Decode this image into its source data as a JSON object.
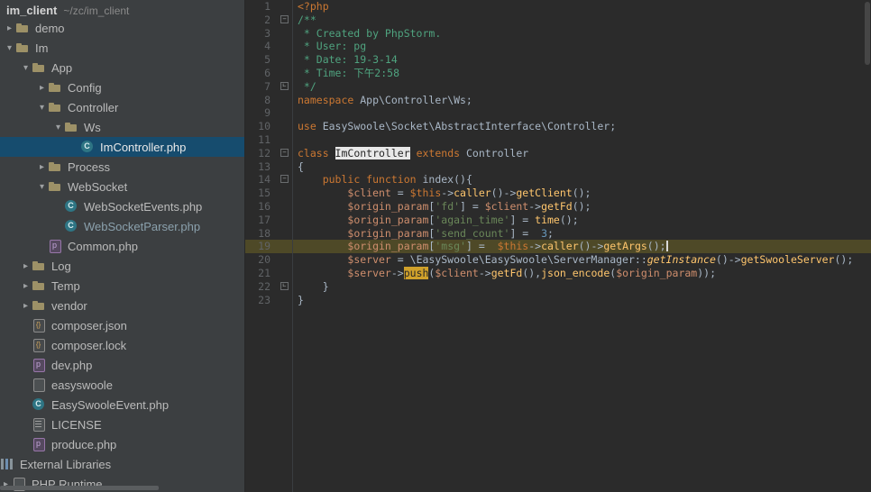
{
  "colors": {
    "editor_bg": "#2b2b2b",
    "sidebar_bg": "#3c3f41",
    "tree_selection": "#164c6e",
    "caret_line": "#4e4927",
    "keyword": "#cc7832",
    "variable": "#cf8e6d",
    "string": "#6a8759",
    "number": "#6897bb",
    "method": "#ffc66d",
    "comment": "#4fa37f",
    "identifier_highlight": "#e8e8e8",
    "usage_highlight": "#d0a12b"
  },
  "sidebar": {
    "root": {
      "name": "im_client",
      "path": "~/zc/im_client"
    },
    "items": [
      {
        "label": "demo",
        "type": "folder",
        "indent": 4,
        "arrow": "right"
      },
      {
        "label": "Im",
        "type": "folder",
        "indent": 4,
        "arrow": "down"
      },
      {
        "label": "App",
        "type": "folder",
        "indent": 22,
        "arrow": "down"
      },
      {
        "label": "Config",
        "type": "folder",
        "indent": 40,
        "arrow": "right"
      },
      {
        "label": "Controller",
        "type": "folder",
        "indent": 40,
        "arrow": "down"
      },
      {
        "label": "Ws",
        "type": "folder",
        "indent": 58,
        "arrow": "down"
      },
      {
        "label": "ImController.php",
        "type": "class",
        "indent": 76,
        "arrow": "blank",
        "selected": true
      },
      {
        "label": "Process",
        "type": "folder",
        "indent": 40,
        "arrow": "right"
      },
      {
        "label": "WebSocket",
        "type": "folder",
        "indent": 40,
        "arrow": "down"
      },
      {
        "label": "WebSocketEvents.php",
        "type": "class",
        "indent": 58,
        "arrow": "blank"
      },
      {
        "label": "WebSocketParser.php",
        "type": "class",
        "indent": 58,
        "arrow": "blank",
        "dim": true
      },
      {
        "label": "Common.php",
        "type": "php",
        "indent": 40,
        "arrow": "blank"
      },
      {
        "label": "Log",
        "type": "folder",
        "indent": 22,
        "arrow": "right"
      },
      {
        "label": "Temp",
        "type": "folder",
        "indent": 22,
        "arrow": "right"
      },
      {
        "label": "vendor",
        "type": "folder",
        "indent": 22,
        "arrow": "right"
      },
      {
        "label": "composer.json",
        "type": "json",
        "indent": 22,
        "arrow": "blank"
      },
      {
        "label": "composer.lock",
        "type": "json",
        "indent": 22,
        "arrow": "blank"
      },
      {
        "label": "dev.php",
        "type": "php",
        "indent": 22,
        "arrow": "blank"
      },
      {
        "label": "easyswoole",
        "type": "file",
        "indent": 22,
        "arrow": "blank"
      },
      {
        "label": "EasySwooleEvent.php",
        "type": "class",
        "indent": 22,
        "arrow": "blank"
      },
      {
        "label": "LICENSE",
        "type": "text",
        "indent": 22,
        "arrow": "blank"
      },
      {
        "label": "produce.php",
        "type": "php",
        "indent": 22,
        "arrow": "blank"
      },
      {
        "label": "External Libraries",
        "type": "lib",
        "indent": 0,
        "arrow": "none"
      },
      {
        "label": "PHP Runtime",
        "type": "file",
        "indent": 0,
        "arrow": "right"
      }
    ]
  },
  "editor": {
    "caret_line": 19,
    "lines": [
      {
        "n": 1,
        "fold": null,
        "t": [
          [
            "<?php",
            "k"
          ]
        ]
      },
      {
        "n": 2,
        "fold": "minus",
        "t": [
          [
            "/**",
            "c"
          ]
        ]
      },
      {
        "n": 3,
        "fold": null,
        "t": [
          [
            " * Created by PhpStorm.",
            "c"
          ]
        ]
      },
      {
        "n": 4,
        "fold": null,
        "t": [
          [
            " * User: pg",
            "c"
          ]
        ]
      },
      {
        "n": 5,
        "fold": null,
        "t": [
          [
            " * Date: 19-3-14",
            "c"
          ]
        ]
      },
      {
        "n": 6,
        "fold": null,
        "t": [
          [
            " * Time: 下午2:58",
            "c"
          ]
        ]
      },
      {
        "n": 7,
        "fold": "end",
        "t": [
          [
            " */",
            "c"
          ]
        ]
      },
      {
        "n": 8,
        "fold": null,
        "t": [
          [
            "namespace",
            "k"
          ],
          [
            " App\\Controller\\Ws;",
            "d"
          ]
        ]
      },
      {
        "n": 9,
        "fold": null,
        "t": []
      },
      {
        "n": 10,
        "fold": null,
        "t": [
          [
            "use",
            "k"
          ],
          [
            " EasySwoole\\Socket\\AbstractInterface\\Controller;",
            "d"
          ]
        ]
      },
      {
        "n": 11,
        "fold": null,
        "t": []
      },
      {
        "n": 12,
        "fold": "minus",
        "t": [
          [
            "class ",
            "k"
          ],
          [
            "ImController",
            "hlw"
          ],
          [
            " ",
            "d"
          ],
          [
            "extends",
            "k"
          ],
          [
            " Controller",
            "d"
          ]
        ]
      },
      {
        "n": 13,
        "fold": null,
        "t": [
          [
            "{",
            "d"
          ]
        ]
      },
      {
        "n": 14,
        "fold": "minus",
        "t": [
          [
            "    ",
            "d"
          ],
          [
            "public function",
            "k"
          ],
          [
            " index(){",
            "d"
          ]
        ]
      },
      {
        "n": 15,
        "fold": null,
        "t": [
          [
            "        ",
            "d"
          ],
          [
            "$client",
            "v"
          ],
          [
            " = ",
            "d"
          ],
          [
            "$this",
            "k"
          ],
          [
            "->",
            "d"
          ],
          [
            "caller",
            "m"
          ],
          [
            "()->",
            "d"
          ],
          [
            "getClient",
            "m"
          ],
          [
            "();",
            "d"
          ]
        ]
      },
      {
        "n": 16,
        "fold": null,
        "t": [
          [
            "        ",
            "d"
          ],
          [
            "$origin_param",
            "v"
          ],
          [
            "[",
            "d"
          ],
          [
            "'fd'",
            "s"
          ],
          [
            "] = ",
            "d"
          ],
          [
            "$client",
            "v"
          ],
          [
            "->",
            "d"
          ],
          [
            "getFd",
            "m"
          ],
          [
            "();",
            "d"
          ]
        ]
      },
      {
        "n": 17,
        "fold": null,
        "t": [
          [
            "        ",
            "d"
          ],
          [
            "$origin_param",
            "v"
          ],
          [
            "[",
            "d"
          ],
          [
            "'again_time'",
            "s"
          ],
          [
            "] = ",
            "d"
          ],
          [
            "time",
            "m"
          ],
          [
            "();",
            "d"
          ]
        ]
      },
      {
        "n": 18,
        "fold": null,
        "t": [
          [
            "        ",
            "d"
          ],
          [
            "$origin_param",
            "v"
          ],
          [
            "[",
            "d"
          ],
          [
            "'send_count'",
            "s"
          ],
          [
            "] =  ",
            "d"
          ],
          [
            "3",
            "n"
          ],
          [
            ";",
            "d"
          ]
        ]
      },
      {
        "n": 19,
        "fold": null,
        "t": [
          [
            "        ",
            "d"
          ],
          [
            "$origin_param",
            "v"
          ],
          [
            "[",
            "d"
          ],
          [
            "'msg'",
            "s"
          ],
          [
            "] =  ",
            "d"
          ],
          [
            "$this",
            "k"
          ],
          [
            "->",
            "d"
          ],
          [
            "caller",
            "m"
          ],
          [
            "()->",
            "d"
          ],
          [
            "getArgs",
            "m"
          ],
          [
            "();",
            "d"
          ]
        ]
      },
      {
        "n": 20,
        "fold": null,
        "t": [
          [
            "        ",
            "d"
          ],
          [
            "$server",
            "v"
          ],
          [
            " = ",
            "d"
          ],
          [
            "\\EasySwoole\\EasySwoole\\ServerManager",
            "d"
          ],
          [
            "::",
            "d"
          ],
          [
            "getInstance",
            "si"
          ],
          [
            "()->",
            "d"
          ],
          [
            "getSwooleServer",
            "m"
          ],
          [
            "();",
            "d"
          ]
        ]
      },
      {
        "n": 21,
        "fold": null,
        "t": [
          [
            "        ",
            "d"
          ],
          [
            "$server",
            "v"
          ],
          [
            "->",
            "d"
          ],
          [
            "push",
            "hly"
          ],
          [
            "(",
            "d"
          ],
          [
            "$client",
            "v"
          ],
          [
            "->",
            "d"
          ],
          [
            "getFd",
            "m"
          ],
          [
            "(),",
            "d"
          ],
          [
            "json_encode",
            "m"
          ],
          [
            "(",
            "d"
          ],
          [
            "$origin_param",
            "v"
          ],
          [
            "));",
            "d"
          ]
        ]
      },
      {
        "n": 22,
        "fold": "end",
        "t": [
          [
            "    }",
            "d"
          ]
        ]
      },
      {
        "n": 23,
        "fold": null,
        "t": [
          [
            "}",
            "d"
          ]
        ]
      }
    ]
  }
}
